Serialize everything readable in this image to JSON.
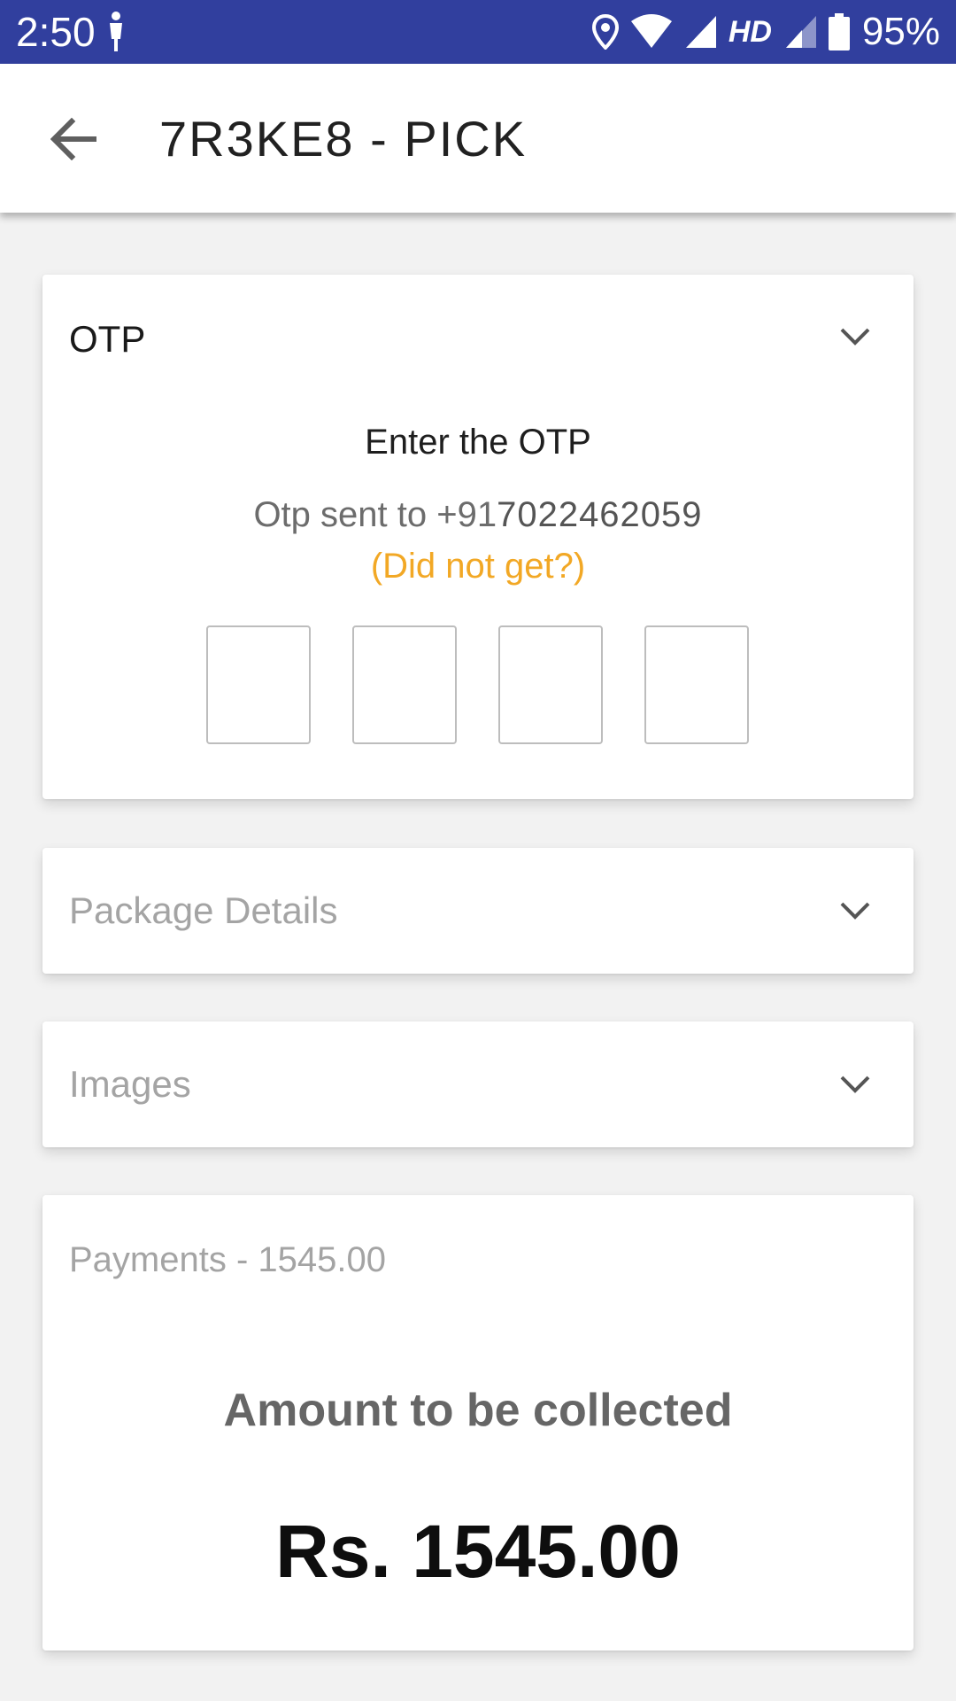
{
  "status_bar": {
    "time": "2:50",
    "hd_label": "HD",
    "battery_percent": "95%",
    "icons": [
      "person-icon",
      "location-icon",
      "wifi-icon",
      "signal-icon",
      "signal-icon",
      "battery-icon"
    ]
  },
  "app_bar": {
    "title": "7R3KE8 - PICK",
    "back_icon": "arrow-back-icon"
  },
  "otp_card": {
    "title": "OTP",
    "heading": "Enter the OTP",
    "sent_prefix": "Otp sent to +91",
    "phone": "7022462059",
    "resend_label": "(Did not get?)",
    "digits": [
      "",
      "",
      "",
      ""
    ]
  },
  "package_card": {
    "title": "Package Details"
  },
  "images_card": {
    "title": "Images"
  },
  "payment_card": {
    "title": "Payments - 1545.00",
    "amount_label": "Amount to be collected",
    "amount_value": "Rs. 1545.00"
  },
  "colors": {
    "status_bar": "#313f9e",
    "accent_link": "#f2a825",
    "background": "#f2f2f2"
  }
}
